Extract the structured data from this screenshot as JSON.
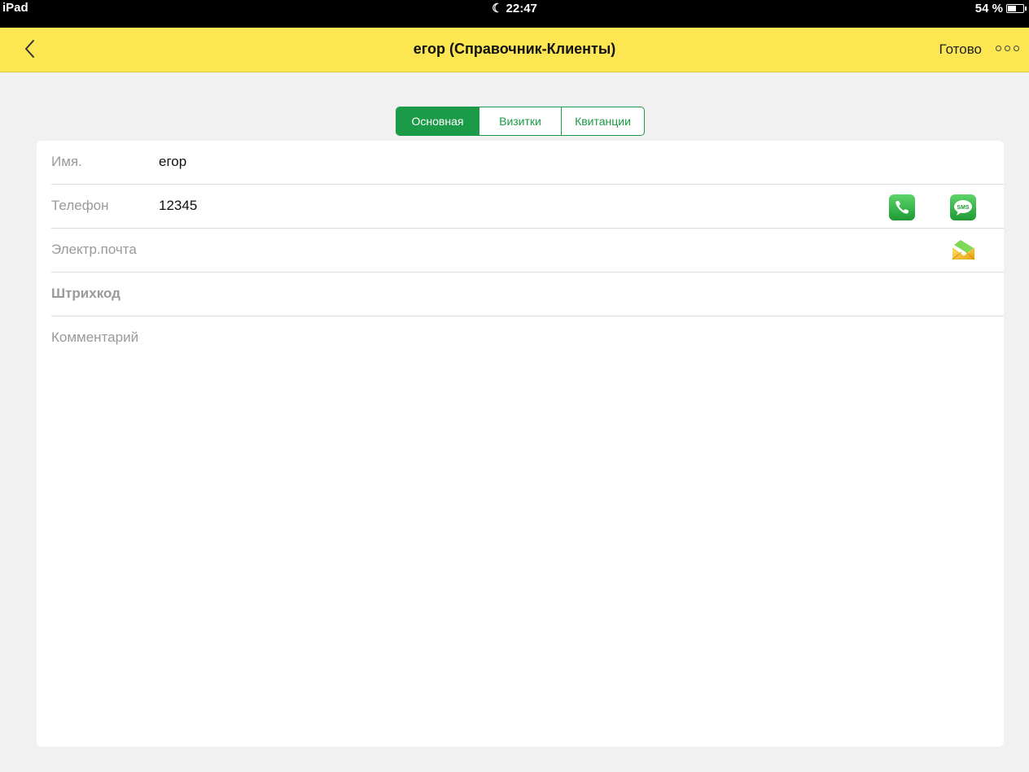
{
  "status_bar": {
    "device": "iPad",
    "time": "22:47",
    "battery": "54 %",
    "battery_level": 0.54
  },
  "nav": {
    "title": "егор (Справочник-Клиенты)",
    "done_label": "Готово"
  },
  "tabs": [
    {
      "label": "Основная",
      "active": true
    },
    {
      "label": "Визитки",
      "active": false
    },
    {
      "label": "Квитанции",
      "active": false
    }
  ],
  "fields": {
    "name": {
      "label": "Имя.",
      "value": "егор"
    },
    "phone": {
      "label": "Телефон",
      "value": "12345"
    },
    "email": {
      "label": "Электр.почта",
      "value": ""
    },
    "barcode": {
      "label": "Штрихкод",
      "value": ""
    },
    "comment": {
      "label": "Комментарий",
      "value": ""
    }
  },
  "icons": {
    "call": "phone-icon",
    "sms": "sms-icon",
    "email": "envelope-icon",
    "sms_text": "SMS"
  },
  "colors": {
    "nav_bar": "#fce752",
    "accent": "#1b9a47",
    "background": "#f1f1f1"
  }
}
